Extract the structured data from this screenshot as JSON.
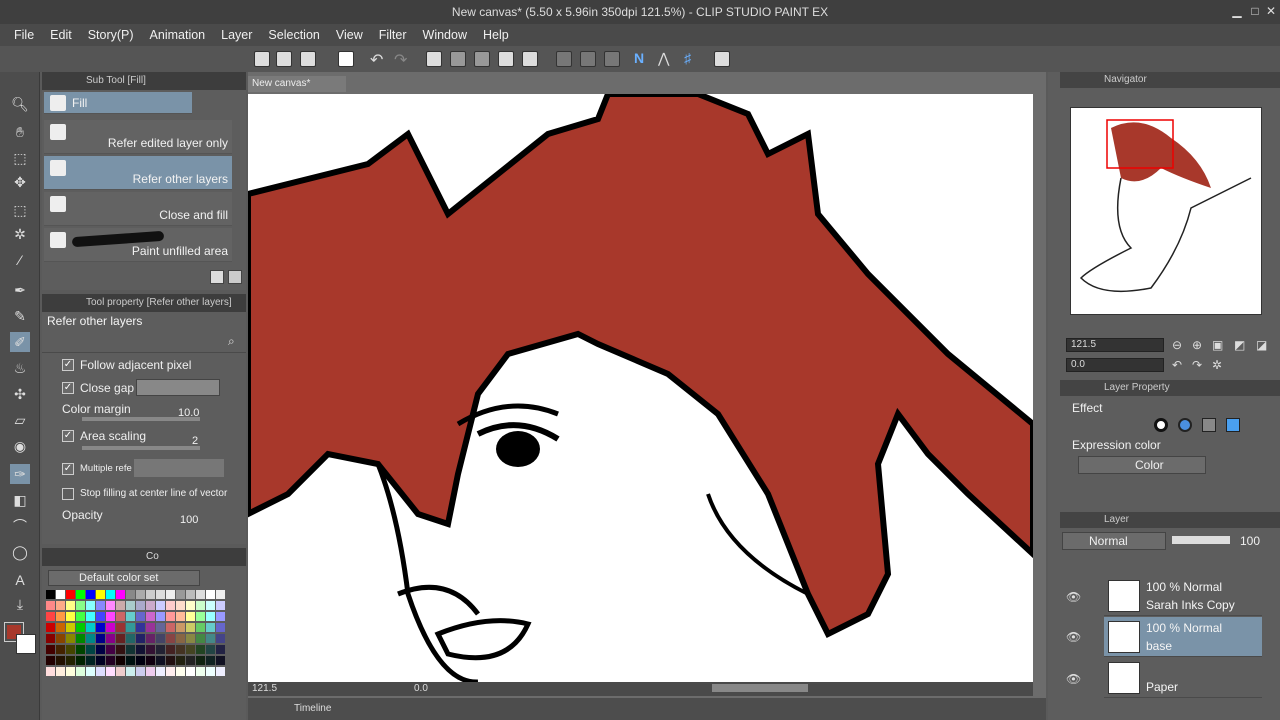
{
  "window": {
    "title": "New canvas* (5.50 x 5.96in 350dpi 121.5%) - CLIP STUDIO PAINT EX"
  },
  "menu": [
    "File",
    "Edit",
    "Story(P)",
    "Animation",
    "Layer",
    "Selection",
    "View",
    "Filter",
    "Window",
    "Help"
  ],
  "subtool": {
    "header": "Sub Tool [Fill]",
    "group": "Fill",
    "items": [
      "Refer edited layer only",
      "Refer other layers",
      "Close and fill",
      "Paint unfilled area"
    ],
    "selected_index": 1
  },
  "toolprop": {
    "header": "Tool property [Refer other layers]",
    "title": "Refer other layers",
    "follow_adjacent": "Follow adjacent pixel",
    "close_gap": "Close gap",
    "color_margin_label": "Color margin",
    "color_margin_value": "10.0",
    "area_scaling_label": "Area scaling",
    "area_scaling_value": "2",
    "multiple_refer": "Multiple refe",
    "stop_filling": "Stop filling at center line of vector",
    "opacity_label": "Opacity",
    "opacity_value": "100"
  },
  "colorset": {
    "tab": "Co",
    "dropdown": "Default color set"
  },
  "canvas": {
    "tab": "New canvas*",
    "zoom": "121.5",
    "rotation": "0.0"
  },
  "navigator": {
    "tab": "Navigator",
    "zoom": "121.5",
    "rotation": "0.0"
  },
  "layer_property": {
    "tab": "Layer Property",
    "effect_label": "Effect",
    "expression_label": "Expression color",
    "expression_value": "Color"
  },
  "layers": {
    "tab": "Layer",
    "blend": "Normal",
    "opacity": "100",
    "items": [
      {
        "pct": "100 %",
        "mode": "Normal",
        "name": "Sarah Inks Copy"
      },
      {
        "pct": "100 %",
        "mode": "Normal",
        "name": "base"
      },
      {
        "pct": "",
        "mode": "",
        "name": "Paper"
      }
    ],
    "selected_index": 1
  },
  "timeline": {
    "label": "Timeline"
  },
  "colors": {
    "hair": "#a8382b",
    "accent": "#7a93a8",
    "main_color": "#a8382b"
  }
}
